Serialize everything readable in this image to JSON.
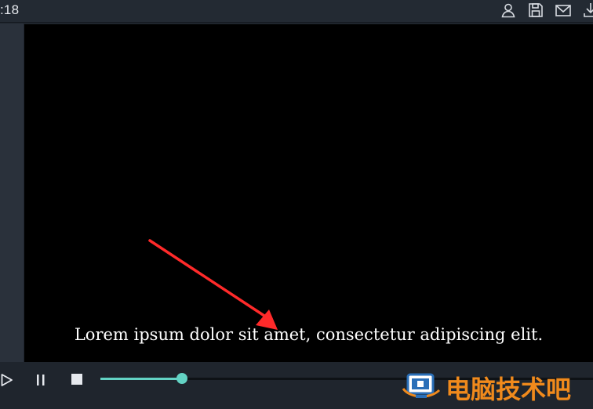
{
  "topbar": {
    "time": ":18",
    "icons": [
      "user-icon",
      "save-icon",
      "mail-icon",
      "download-icon"
    ]
  },
  "video": {
    "subtitle": "Lorem ipsum dolor sit amet, consectetur adipiscing elit."
  },
  "controls": {
    "progress_fraction": 0.165,
    "accent_color": "#63d3c4"
  },
  "watermark": {
    "text": "电脑技术吧",
    "color": "#f08a1c"
  },
  "colors": {
    "background": "#1f252d",
    "video": "#000000",
    "annotation_arrow": "#ff2a2a"
  }
}
